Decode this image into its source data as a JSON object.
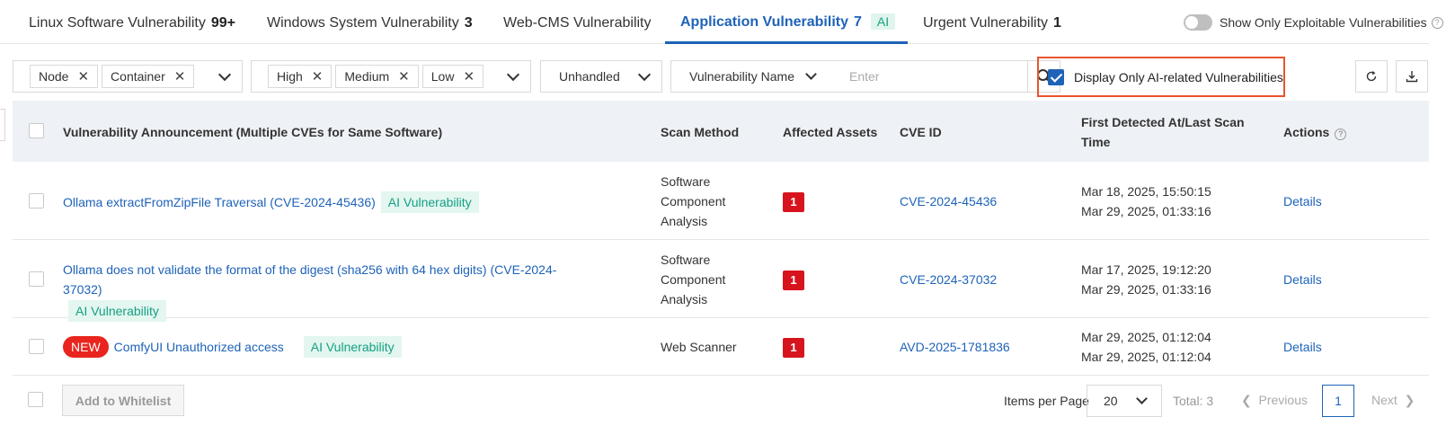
{
  "tabs": [
    {
      "label": "Linux Software Vulnerability",
      "count": "99+"
    },
    {
      "label": "Windows System Vulnerability",
      "count": "3"
    },
    {
      "label": "Web-CMS Vulnerability",
      "count": ""
    },
    {
      "label": "Application Vulnerability",
      "count": "7",
      "badge": "AI"
    },
    {
      "label": "Urgent Vulnerability",
      "count": "1"
    }
  ],
  "active_tab": "Application Vulnerability",
  "exploitable_toggle": {
    "label": "Show Only Exploitable Vulnerabilities",
    "on": false
  },
  "filters": {
    "asset_type_chips": [
      "Node",
      "Container"
    ],
    "severity_chips": [
      "High",
      "Medium",
      "Low"
    ],
    "status": "Unhandled",
    "search_field": "Vulnerability Name",
    "search_placeholder": "Enter",
    "ai_only_label": "Display Only AI-related Vulnerabilities",
    "ai_only_checked": true
  },
  "table": {
    "headers": {
      "announcement": "Vulnerability Announcement (Multiple CVEs for Same Software)",
      "scan_method": "Scan Method",
      "affected_assets": "Affected Assets",
      "cve_id": "CVE ID",
      "detected": "First Detected At/Last Scan Time",
      "actions": "Actions"
    },
    "rows": [
      {
        "title": "Ollama extractFromZipFile Traversal (CVE-2024-45436)",
        "tag": "AI Vulnerability",
        "scan_method": "Software Component Analysis",
        "affected": "1",
        "cve": "CVE-2024-45436",
        "first_detected": "Mar 18, 2025, 15:50:15",
        "last_scan": "Mar 29, 2025, 01:33:16",
        "action": "Details"
      },
      {
        "title": "Ollama does not validate the format of the digest (sha256 with 64 hex digits) (CVE-2024-37032)",
        "tag": "AI Vulnerability",
        "scan_method": "Software Component Analysis",
        "affected": "1",
        "cve": "CVE-2024-37032",
        "first_detected": "Mar 17, 2025, 19:12:20",
        "last_scan": "Mar 29, 2025, 01:33:16",
        "action": "Details"
      },
      {
        "new_badge": "NEW",
        "title": "ComfyUI Unauthorized access",
        "tag": "AI Vulnerability",
        "scan_method": "Web Scanner",
        "affected": "1",
        "cve": "AVD-2025-1781836",
        "first_detected": "Mar 29, 2025, 01:12:04",
        "last_scan": "Mar 29, 2025, 01:12:04",
        "action": "Details"
      }
    ]
  },
  "footer": {
    "whitelist_button": "Add to Whitelist",
    "items_per_page_label": "Items per Page",
    "items_per_page": "20",
    "total": "Total: 3",
    "previous": "Previous",
    "current_page": "1",
    "next": "Next"
  },
  "colors": {
    "accent": "#1e63b8",
    "danger": "#d7141e",
    "highlight_border": "#e8552d",
    "ai_tag_bg": "#e3f6ef",
    "ai_tag_text": "#16a085"
  }
}
